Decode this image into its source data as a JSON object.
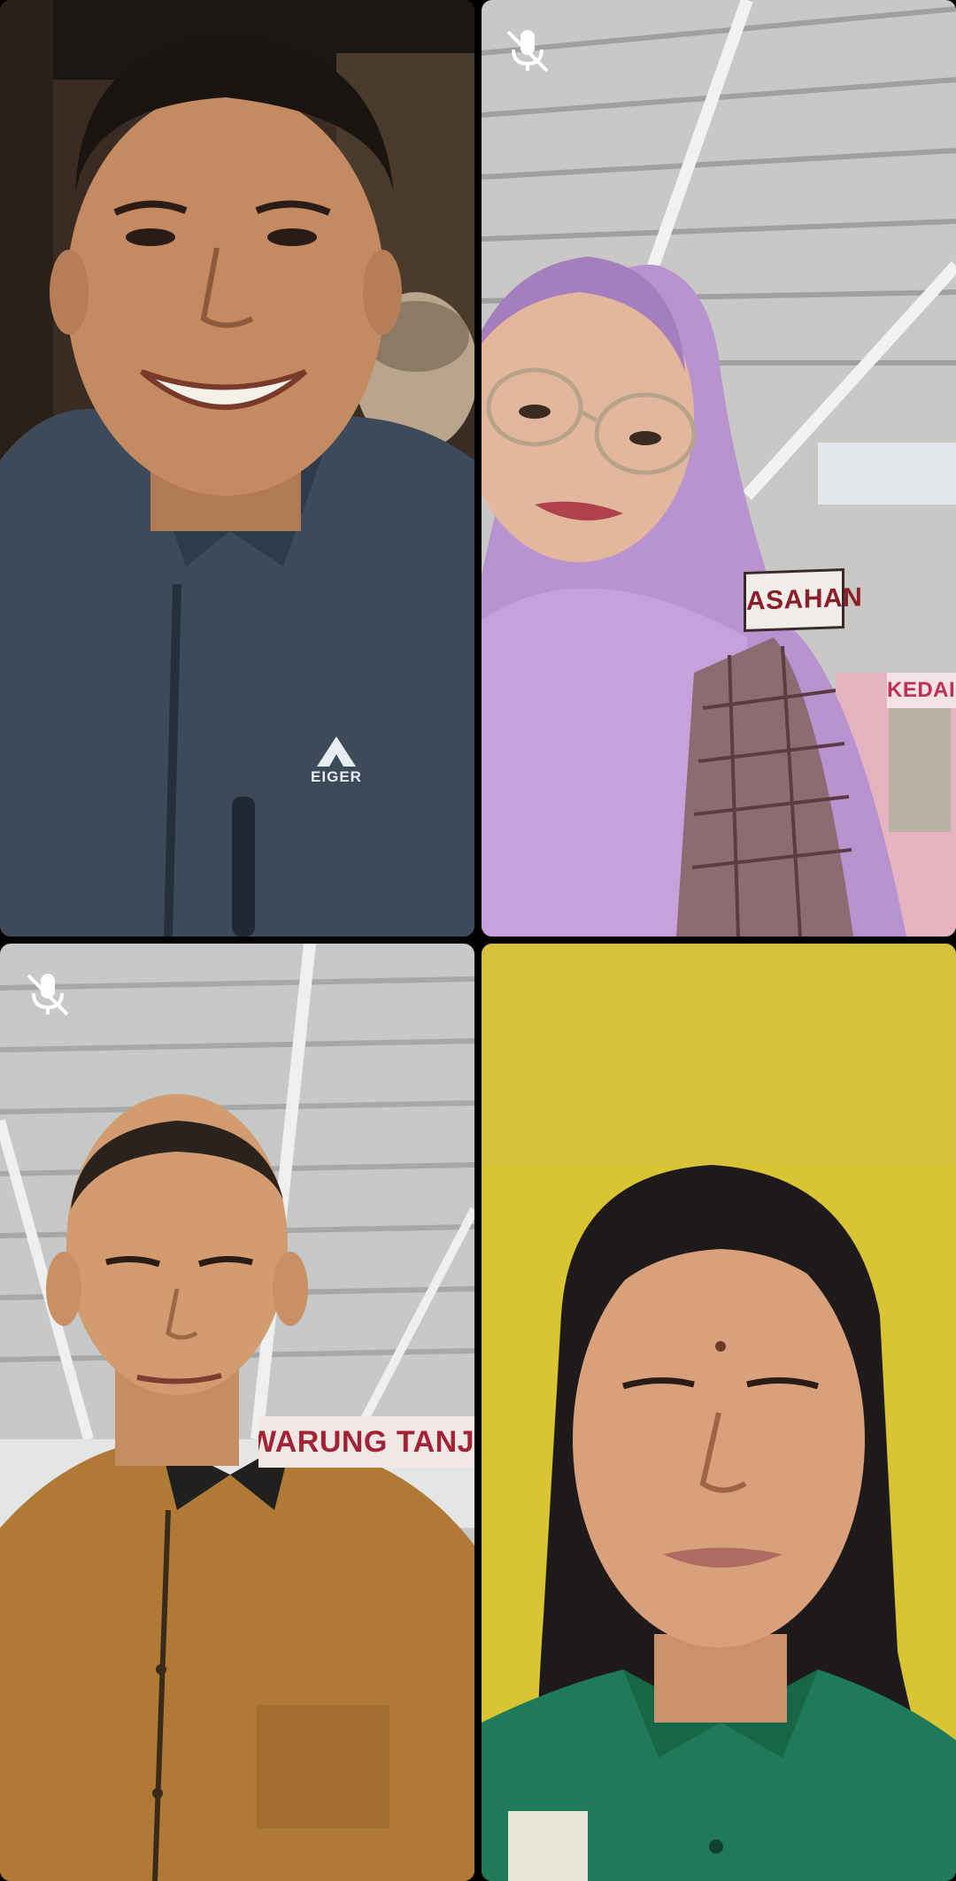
{
  "call": {
    "participants": [
      {
        "position": "top-left",
        "muted": false
      },
      {
        "position": "top-right",
        "muted": true,
        "mute_icon": "mic-off-icon"
      },
      {
        "position": "bottom-left",
        "muted": true,
        "mute_icon": "mic-off-icon"
      },
      {
        "position": "bottom-right",
        "muted": false
      }
    ]
  },
  "scene_text": {
    "jacket_logo": "EIGER",
    "sign_top_right": "ASAHAN",
    "sign_shop": "KEDAI GE",
    "sign_bottom_left": "WARUNG TANJUNG"
  },
  "colors": {
    "background": "#000000",
    "mute_icon": "#ffffff"
  }
}
